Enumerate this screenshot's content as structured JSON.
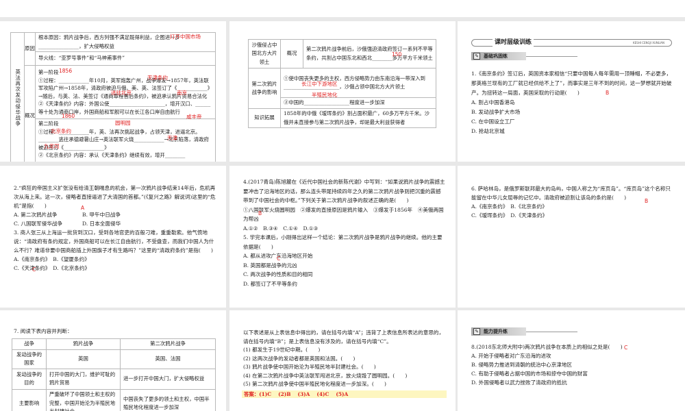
{
  "slide1": {
    "side": "英法再次发动侵华战争",
    "cause": "原因",
    "overview": "概况",
    "cause1": "根本原因：鸦片战争后，西方列强不满足既得利益，企图进一步________________，扩大侵略权益",
    "cause2": "导火线：“亚罗号事件”和“马神甫事件”",
    "stage1": [
      "第一阶段",
      "①过程：____________年10月，英军炮轰广州，战争爆发→1857年，英法联军攻陷广州→1858年，清政府被迫与俄、美、英、法签订了《____________》→随后，与英、法、美签订《通商章程善后条约》，被迫承认鸦片贸易合法化",
      "②《天津条约》内容：外国公使______________________，增开汉口、______等十处为通商口岸，外国商船和军舰可以在长江各口岸自由航行"
    ],
    "stage2": [
      "第二阶段",
      "①过程：____________年，英、法再次挑起战争，占领天津，进逼北京。________逃往承德避暑山庄→英法联军火烧____________→北京陷落，清政府被迫签订《________________》",
      "②《北京条约》内容：承认《天津条约》继续有效，增开________"
    ],
    "answers": [
      "打开中国市场",
      "1856",
      "天津条约",
      "进驻北京",
      "南京",
      "1860",
      "咸丰帝",
      "圆明园",
      "北京条约",
      "天津",
      "九龙司"
    ]
  },
  "slide2": {
    "r1a": "沙俄侵占中国北方大片领土",
    "r1b": "概况",
    "r1c": "第二次鸦片战争前后，沙俄强迫清政府签订一系列不平等条约，共割占中国东北和西北________多万平方千米领土",
    "r2a": "第二次鸦片战争的影响",
    "r2c1": "①使中国丧失更多的主权，西方侵略势力由东南沿海一带深入到______________________，沙俄占领中国北方大片领土",
    "r2c2": "②中国的__________________程度进一步加深",
    "r3a": "知识拓展",
    "r3c": "1858年的中俄《瑷珲条约》割占面积最广，60多万平方千米。沙俄并未直接参与第二次鸦片战争，却是最大利益获得者",
    "answers": [
      "150",
      "长江中下游地区",
      "半殖民地化"
    ]
  },
  "slide3": {
    "banner": "课时层级训练",
    "banner_en": "KESHI CENGJI XUNLIAN",
    "sub": "基础巩固练",
    "q": "1.《南京条约》签订后，英国资本家相信“只要中国每人每年需用一顶睡帽，不必更多，那英格兰现有的工厂就已经供给不上了”，而事实是三年不到的时间，这一梦想就开始破产。为扭转这一局面，英国采取的行动是(　　)",
    "opts": [
      "A. 割占中国香港岛",
      "B. 发动战争扩大市场",
      "C. 在中国设立工厂",
      "D. 抢劫北京城"
    ],
    "answer": "B"
  },
  "slide4": {
    "q2": "2.“疯狂的帝国主义扩张没有给清王朝喘息的机会，第一次鸦片战争结束14年后，危机再次从海上来。这一次，侵略者直接逼进了大清国的首都。”(《复兴之路》解说词)这里的“危机”是指(　　)",
    "q2opts": [
      "A. 第二次鸦片战争",
      "B. 甲午中日战争",
      "C. 八国联军侵华战争",
      "D. 日本全面侵华"
    ],
    "q2ans": "A",
    "q3": "3. 商人张三从上海运一批货到汉口，受到各地官吏的百般刁难，重重勒索。他气愤地说：“清政府有条约规定，外国商船可以在长江自由航行，不受盘查，而我们中国人为什么不行？难道非要中国商船插上外国旗子才有生路吗？”这里的“清政府条约”是指(　　)",
    "q3opts": [
      "A.《南京条约》　B.《望厦条约》",
      "C.《天津条约》　D.《北京条约》"
    ],
    "q3ans": "C"
  },
  "slide5": {
    "q4": "4.(2017青岛)陈旭麓在《近代中国社会的新陈代谢》中写到：“如果说鸦片战争的震撼主要冲击了沿海地区的话，那么连头带尾持续四年之久的第二次鸦片战争则把沉重的震撼带到了中国社会的中枢。”下列关于第二次鸦片战争的叙述正确的是(　　)",
    "q4items": "①八国联军火烧圆明园　②爆发的直接原因是鸦片输入　③爆发于1856年　④美俄两国为帮凶",
    "q4opts": "A.①②　B.③④　C.①④　D.①③",
    "q4ans": "B",
    "q5": "5. 学完本课后，小刚得出这样一个结论：第二次鸦片战争是鸦片战争的继续。他的主要依据是(　　)",
    "q5opts": [
      "A. 都从进攻广东沿海地区开始",
      "B. 英国都是战争的元凶",
      "C. 两次战争的性质和目的相同",
      "D. 都签订了不平等条约"
    ],
    "q5ans": "C"
  },
  "slide6": {
    "q": "6. 萨哈林岛，是俄罗斯联邦最大的岛屿，中国人称之为“库页岛”。“库页岛”这个名称只能留在中华儿女屈辱的记忆中。清政府被迫割让该岛的条约是(　　)",
    "opts": [
      "A.《南京条约》　B.《北京条约》",
      "C.《瑷珲条约》　D.《天津条约》"
    ],
    "answer": "B"
  },
  "slide7": {
    "q": "7. 阅读下表内容并判断：",
    "table": [
      [
        "战争",
        "鸦片战争",
        "第二次鸦片战争"
      ],
      [
        "发动战争的国家",
        "英国",
        "英国、法国"
      ],
      [
        "发动战争的目的",
        "打开中国的大门，维护可耻的鸦片贸易",
        "进一步打开中国大门，扩大侵略权益"
      ],
      [
        "主要影响",
        "严重破坏了中国领土和主权的完整，中国开始沦为半殖民地半封建社会",
        "中国丧失了更多的领土和主权，中国半殖民地化程度进一步加深"
      ]
    ]
  },
  "slide8": {
    "intro": "以下表述是从上表信息中得出的，请在括号内填“A”；违背了上表信息所表达的意思的，请在括号内填“B”；是上表信息没有涉及的，请在括号内填“C”。",
    "items": [
      "(1) 都发生于19世纪中期。(　　)",
      "(2) 这两次战争的发动者都是英国和法国。(　　)",
      "(3) 鸦片战争使中国开始沦为半殖民地半封建社会。(　　)",
      "(4) 在第二次鸦片战争中英法联军闯进北京，放火烧毁了圆明园。(　　)",
      "(5) 第二次鸦片战争使中国半殖民地化程度进一步加深。(　　)"
    ],
    "answer": "答案：(1)C　 (2)B　 (3)A　 (4)C　 (5)A"
  },
  "slide9": {
    "sub": "能力提升练",
    "q": "8.(2018东北师大附中)两次鸦片战争在本质上的相似之处是(　　)",
    "opts": [
      "A. 开始于侵略者对广东沿海的进攻",
      "B. 侵略势力推进到清朝的统治中心京津地区",
      "C. 有助于侵略者占据中国的市场和掠夺中国的财富",
      "D. 外国侵略者以武力挫败了清政府的抵抗"
    ],
    "answer": "C"
  }
}
